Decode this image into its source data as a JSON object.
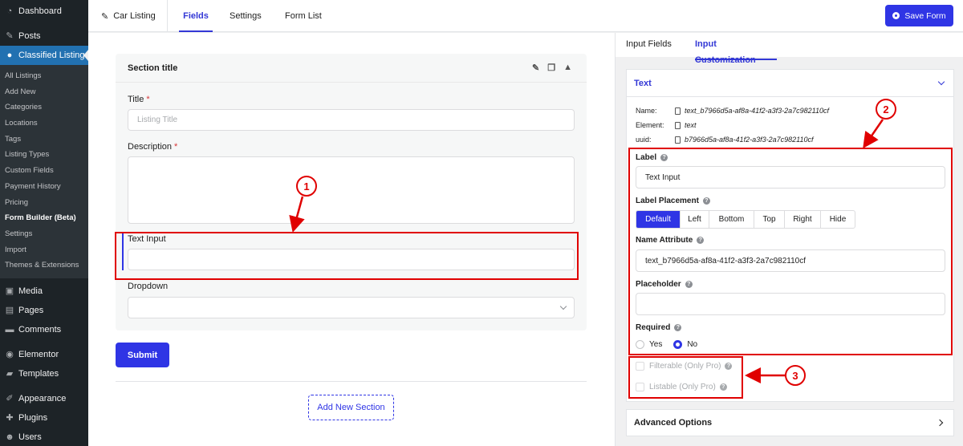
{
  "sidebar": {
    "top_items": [
      {
        "label": "Dashboard",
        "icon": "dashboard-icon"
      },
      {
        "label": "Posts",
        "icon": "pin-icon"
      },
      {
        "label": "Classified Listing",
        "icon": "location-icon"
      }
    ],
    "sub_items": [
      "All Listings",
      "Add New",
      "Categories",
      "Locations",
      "Tags",
      "Listing Types",
      "Custom Fields",
      "Payment History",
      "Pricing",
      "Form Builder (Beta)",
      "Settings",
      "Import",
      "Themes & Extensions"
    ],
    "bottom_items": [
      {
        "label": "Media",
        "icon": "media-icon"
      },
      {
        "label": "Pages",
        "icon": "pages-icon"
      },
      {
        "label": "Comments",
        "icon": "comments-icon"
      },
      {
        "label": "Elementor",
        "icon": "elementor-icon"
      },
      {
        "label": "Templates",
        "icon": "folder-icon"
      },
      {
        "label": "Appearance",
        "icon": "brush-icon"
      },
      {
        "label": "Plugins",
        "icon": "plug-icon"
      },
      {
        "label": "Users",
        "icon": "user-icon"
      }
    ]
  },
  "topbar": {
    "title": "Car Listing",
    "tabs": [
      "Fields",
      "Settings",
      "Form List"
    ],
    "save_label": "Save Form"
  },
  "builder": {
    "section_title": "Section title",
    "fields": {
      "title_label": "Title",
      "title_placeholder": "Listing Title",
      "description_label": "Description",
      "text_input_label": "Text Input",
      "dropdown_label": "Dropdown"
    },
    "submit_label": "Submit",
    "add_section_label": "Add New Section"
  },
  "panel": {
    "tabs": [
      "Input Fields",
      "Input Customization"
    ],
    "card_title": "Text",
    "meta": {
      "name_key": "Name:",
      "name_val": "text_b7966d5a-af8a-41f2-a3f3-2a7c982110cf",
      "element_key": "Element:",
      "element_val": "text",
      "uuid_key": "uuid:",
      "uuid_val": "b7966d5a-af8a-41f2-a3f3-2a7c982110cf"
    },
    "label_heading": "Label",
    "label_value": "Text Input",
    "placement_heading": "Label Placement",
    "placement_options": [
      "Default",
      "Left",
      "Bottom",
      "Top",
      "Right",
      "Hide"
    ],
    "name_attr_heading": "Name Attribute",
    "name_attr_value": "text_b7966d5a-af8a-41f2-a3f3-2a7c982110cf",
    "placeholder_heading": "Placeholder",
    "required_heading": "Required",
    "required_yes": "Yes",
    "required_no": "No",
    "filterable": "Filterable (Only Pro)",
    "listable": "Listable (Only Pro)",
    "advanced": "Advanced Options"
  },
  "annotations": {
    "one": "1",
    "two": "2",
    "three": "3"
  },
  "colors": {
    "accent": "#2f35e5",
    "annotation": "#e00000",
    "sidebar": "#1d2327"
  }
}
